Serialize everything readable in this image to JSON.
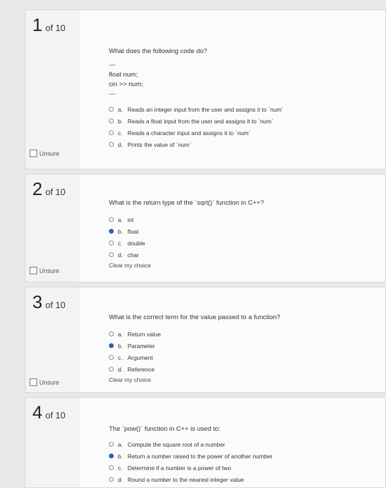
{
  "unsure_label": "Unsure",
  "clear_label": "Clear my choice",
  "questions": [
    {
      "number": "1",
      "of": "of 10",
      "text": "What does the following code do?",
      "code": [
        "---",
        "float num;",
        "cin >> num;",
        "---"
      ],
      "options": [
        {
          "letter": "a.",
          "text": "Reads an integer input from the user and assigns it to `num`",
          "selected": false
        },
        {
          "letter": "b.",
          "text": "Reads a float input from the user and assigns it to `num`",
          "selected": false
        },
        {
          "letter": "c.",
          "text": "Reads a character input and assigns it to `num`",
          "selected": false
        },
        {
          "letter": "d.",
          "text": "Prints the value of `num`",
          "selected": false
        }
      ]
    },
    {
      "number": "2",
      "of": "of 10",
      "text": "What is the return type of the `sqrt()` function in C++?",
      "options": [
        {
          "letter": "a.",
          "text": "int",
          "selected": false
        },
        {
          "letter": "b.",
          "text": "float",
          "selected": true
        },
        {
          "letter": "c.",
          "text": "double",
          "selected": false
        },
        {
          "letter": "d.",
          "text": "char",
          "selected": false
        }
      ]
    },
    {
      "number": "3",
      "of": "of 10",
      "text": "What is the correct term for the value passed to a function?",
      "options": [
        {
          "letter": "a.",
          "text": "Return value",
          "selected": false
        },
        {
          "letter": "b.",
          "text": "Parameter",
          "selected": true
        },
        {
          "letter": "c.",
          "text": "Argument",
          "selected": false
        },
        {
          "letter": "d.",
          "text": "Reference",
          "selected": false
        }
      ]
    },
    {
      "number": "4",
      "of": "of 10",
      "text": "The `pow()` function in C++ is used to:",
      "options": [
        {
          "letter": "a.",
          "text": "Compute the square root of a number",
          "selected": false
        },
        {
          "letter": "b.",
          "text": "Return a number raised to the power of another number",
          "selected": true
        },
        {
          "letter": "c.",
          "text": "Determine if a number is a power of two",
          "selected": false
        },
        {
          "letter": "d.",
          "text": "Round a number to the nearest integer value",
          "selected": false
        }
      ]
    }
  ]
}
